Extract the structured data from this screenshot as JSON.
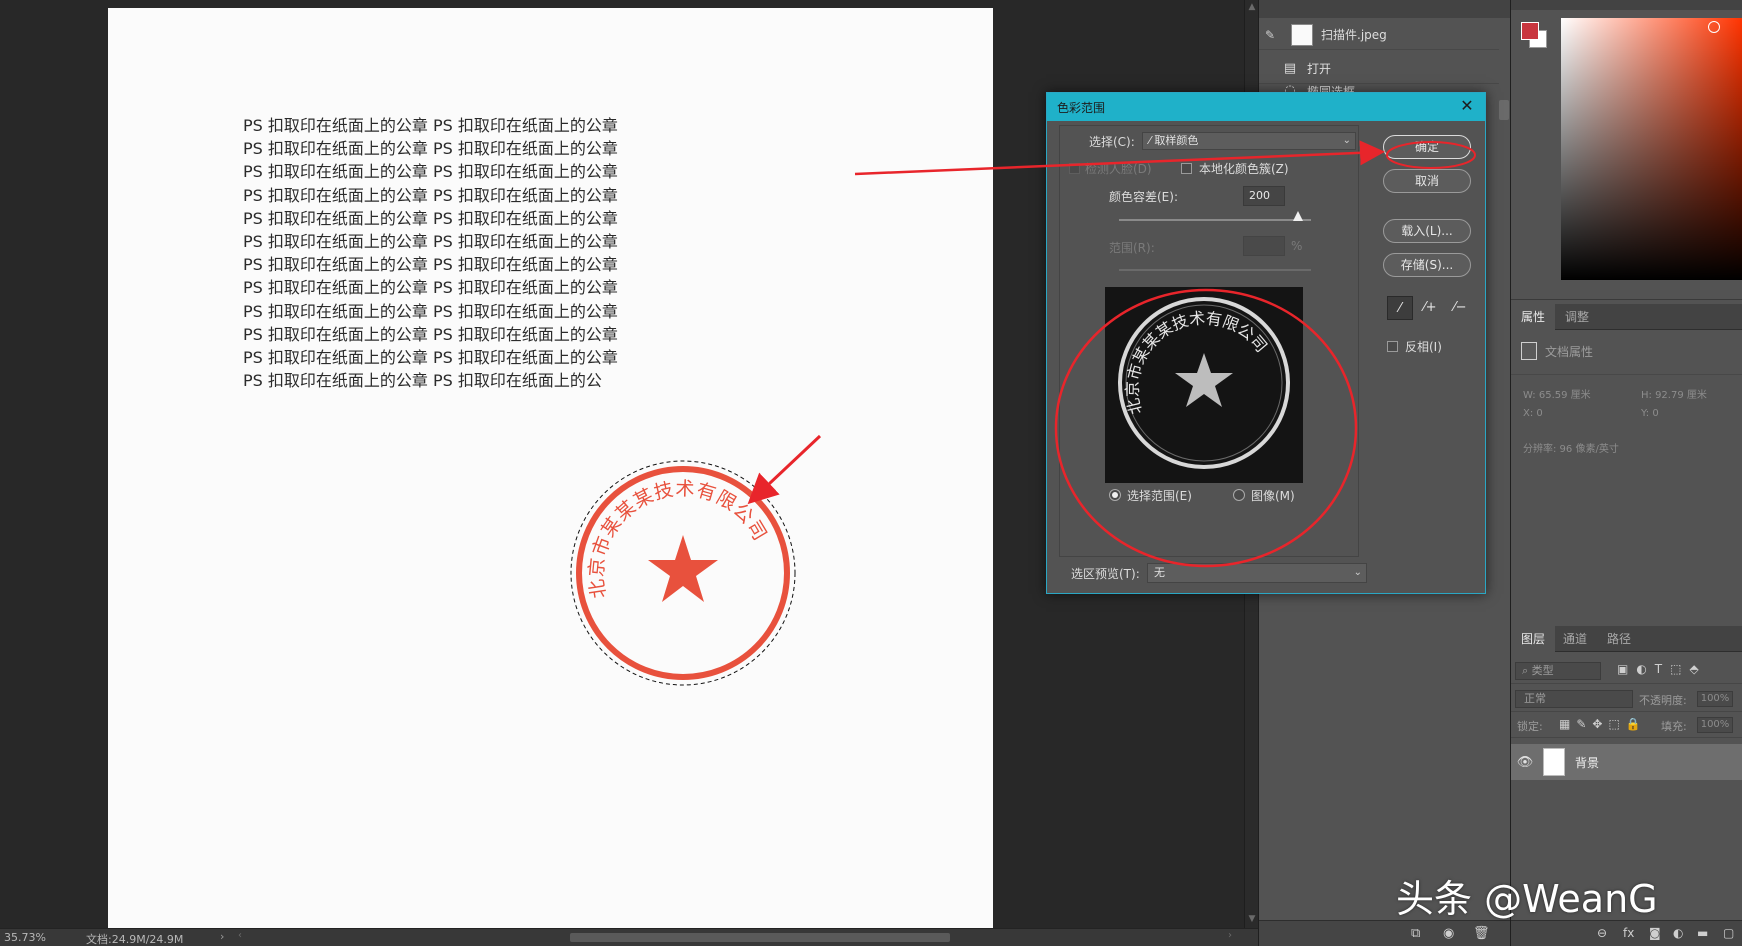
{
  "document": {
    "text_lines": [
      "PS 扣取印在纸面上的公章 PS 扣取印在纸面上的公章",
      "PS 扣取印在纸面上的公章 PS 扣取印在纸面上的公章",
      "PS 扣取印在纸面上的公章 PS 扣取印在纸面上的公章",
      "PS 扣取印在纸面上的公章 PS 扣取印在纸面上的公章",
      "PS 扣取印在纸面上的公章 PS 扣取印在纸面上的公章",
      "PS 扣取印在纸面上的公章 PS 扣取印在纸面上的公章",
      "PS 扣取印在纸面上的公章 PS 扣取印在纸面上的公章",
      "PS 扣取印在纸面上的公章 PS 扣取印在纸面上的公章",
      "PS 扣取印在纸面上的公章 PS 扣取印在纸面上的公章",
      "PS 扣取印在纸面上的公章 PS 扣取印在纸面上的公章",
      "PS 扣取印在纸面上的公章 PS 扣取印在纸面上的公章",
      "PS 扣取印在纸面上的公章 PS 扣取印在纸面上的公"
    ],
    "stamp_text": "北京市某某某技术有限公司",
    "stamp_color": "#e8513d"
  },
  "status_bar": {
    "zoom": "35.73%",
    "doc_size": "文档:24.9M/24.9M",
    "chevron": "›"
  },
  "history_panel": {
    "snapshot_name": "扫描件.jpeg",
    "steps": [
      "打开",
      "椭圆选框"
    ]
  },
  "color_range_dialog": {
    "title": "色彩范围",
    "close": "✕",
    "select_label": "选择(C):",
    "select_value": "取样颜色",
    "detect_faces_label": "检测人脸(D)",
    "localized_clusters_label": "本地化颜色簇(Z)",
    "fuzziness_label": "颜色容差(E):",
    "fuzziness_value": "200",
    "fuzziness_fraction": 0.93,
    "range_label": "范围(R):",
    "range_unit": "%",
    "radio_selection": "选择范围(E)",
    "radio_image": "图像(M)",
    "selection_preview_label": "选区预览(T):",
    "selection_preview_value": "无",
    "buttons": {
      "ok": "确定",
      "cancel": "取消",
      "load": "载入(L)...",
      "save": "存储(S)..."
    },
    "invert_label": "反相(I)"
  },
  "properties_panel": {
    "tabs": [
      "属性",
      "调整"
    ],
    "doc_props": "文档属性",
    "w": "W:  65.59 厘米",
    "h": "H:  92.79 厘米",
    "x": "X:  0",
    "y": "Y:  0",
    "resolution": "分辨率: 96 像素/英寸"
  },
  "layers_panel": {
    "tabs": [
      "图层",
      "通道",
      "路径"
    ],
    "filter_kind": "类型",
    "blend_mode": "正常",
    "opacity_label": "不透明度:",
    "opacity_value": "100%",
    "lock_label": "锁定:",
    "fill_label": "填充:",
    "fill_value": "100%",
    "layer_name": "背景"
  },
  "colors": {
    "foreground": "#c9363f",
    "background": "#ffffff",
    "annotation_red": "#e8252b",
    "dialog_title_bar": "#1fb1c9"
  },
  "watermark": "头条 @WeanG"
}
